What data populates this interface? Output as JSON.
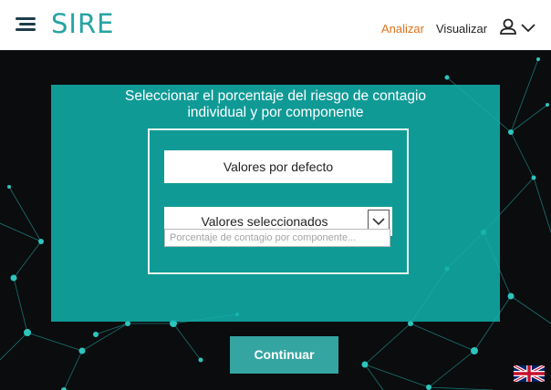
{
  "header": {
    "logo": "SIRE",
    "nav": {
      "analizar": "Analizar",
      "visualizar": "Visualizar"
    },
    "active_color": "#e0711d"
  },
  "panel": {
    "title_line1": "Seleccionar el porcentaje del riesgo de contagio",
    "title_line2": "individual y por componente",
    "default_button": "Valores por defecto",
    "selected_dropdown": "Valores seleccionados",
    "component_placeholder": "Porcentaje de contagio por componente..."
  },
  "continue_button": "Continuar",
  "icons": [
    "menu-icon",
    "user-icon",
    "chevron-down-icon",
    "uk-flag-icon"
  ],
  "colors": {
    "brand": "#26a3a3",
    "panel": "#12b2ac",
    "button": "#35a5a2"
  }
}
